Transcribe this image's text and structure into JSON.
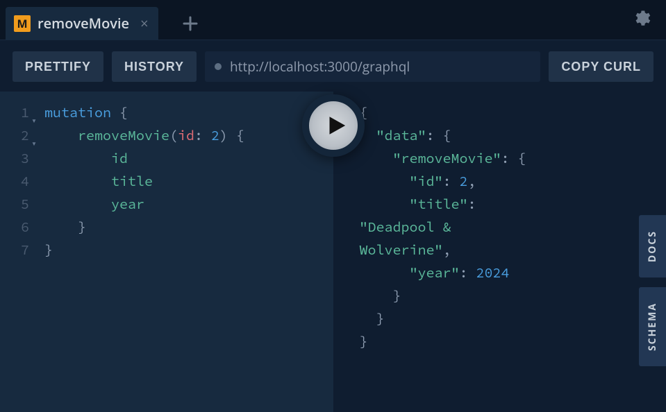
{
  "tab": {
    "icon_letter": "M",
    "title": "removeMovie"
  },
  "toolbar": {
    "prettify": "PRETTIFY",
    "history": "HISTORY",
    "url": "http://localhost:3000/graphql",
    "copy_curl": "COPY CURL"
  },
  "editor": {
    "lines": [
      "1",
      "2",
      "3",
      "4",
      "5",
      "6",
      "7"
    ],
    "tokens": [
      [
        {
          "t": "kw",
          "v": "mutation"
        },
        {
          "t": "punct",
          "v": " {"
        }
      ],
      [
        {
          "t": "sp",
          "v": "    "
        },
        {
          "t": "fn",
          "v": "removeMovie"
        },
        {
          "t": "punct",
          "v": "("
        },
        {
          "t": "param",
          "v": "id"
        },
        {
          "t": "punct",
          "v": ": "
        },
        {
          "t": "num",
          "v": "2"
        },
        {
          "t": "punct",
          "v": ") {"
        }
      ],
      [
        {
          "t": "sp",
          "v": "        "
        },
        {
          "t": "fld",
          "v": "id"
        }
      ],
      [
        {
          "t": "sp",
          "v": "        "
        },
        {
          "t": "fld",
          "v": "title"
        }
      ],
      [
        {
          "t": "sp",
          "v": "        "
        },
        {
          "t": "fld",
          "v": "year"
        }
      ],
      [
        {
          "t": "sp",
          "v": "    "
        },
        {
          "t": "punct",
          "v": "}"
        }
      ],
      [
        {
          "t": "punct",
          "v": "}"
        }
      ]
    ]
  },
  "result": {
    "fold_rows": [
      true,
      true,
      true,
      false,
      false,
      false,
      false,
      false,
      false,
      false,
      false
    ],
    "tokens": [
      [
        {
          "t": "jpunct",
          "v": "{"
        }
      ],
      [
        {
          "t": "sp",
          "v": "  "
        },
        {
          "t": "key",
          "v": "\"data\""
        },
        {
          "t": "jpunct",
          "v": ": {"
        }
      ],
      [
        {
          "t": "sp",
          "v": "    "
        },
        {
          "t": "key",
          "v": "\"removeMovie\""
        },
        {
          "t": "jpunct",
          "v": ": {"
        }
      ],
      [
        {
          "t": "sp",
          "v": "      "
        },
        {
          "t": "key",
          "v": "\"id\""
        },
        {
          "t": "jpunct",
          "v": ": "
        },
        {
          "t": "jnum",
          "v": "2"
        },
        {
          "t": "jpunct",
          "v": ","
        }
      ],
      [
        {
          "t": "sp",
          "v": "      "
        },
        {
          "t": "key",
          "v": "\"title\""
        },
        {
          "t": "jpunct",
          "v": ": "
        }
      ],
      [
        {
          "t": "str",
          "v": "\"Deadpool & "
        }
      ],
      [
        {
          "t": "str",
          "v": "Wolverine\""
        },
        {
          "t": "jpunct",
          "v": ","
        }
      ],
      [
        {
          "t": "sp",
          "v": "      "
        },
        {
          "t": "key",
          "v": "\"year\""
        },
        {
          "t": "jpunct",
          "v": ": "
        },
        {
          "t": "jnum",
          "v": "2024"
        }
      ],
      [
        {
          "t": "sp",
          "v": "    "
        },
        {
          "t": "jpunct",
          "v": "}"
        }
      ],
      [
        {
          "t": "sp",
          "v": "  "
        },
        {
          "t": "jpunct",
          "v": "}"
        }
      ],
      [
        {
          "t": "jpunct",
          "v": "}"
        }
      ]
    ]
  },
  "side": {
    "docs": "DOCS",
    "schema": "SCHEMA"
  }
}
